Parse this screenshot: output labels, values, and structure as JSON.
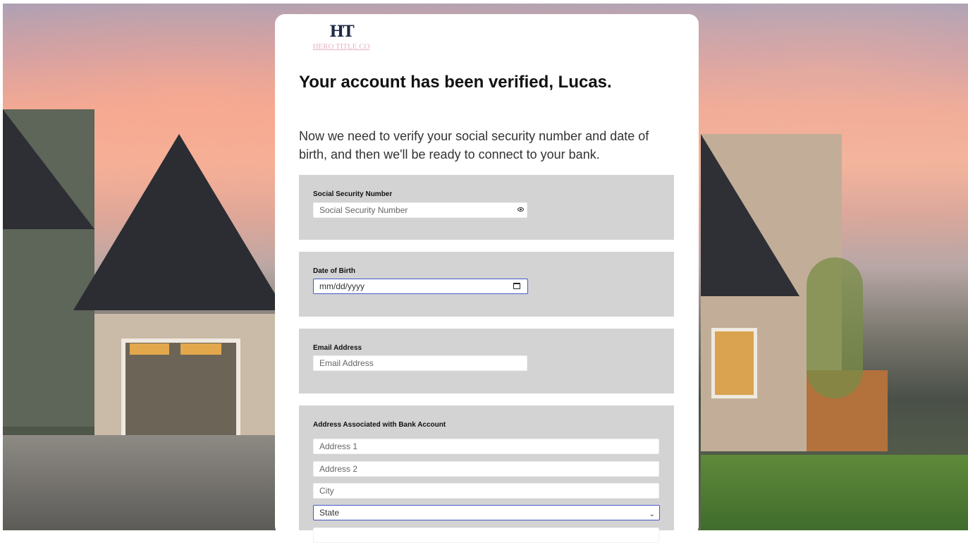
{
  "brand": {
    "logo_mark": "HT",
    "logo_text": "HERO TITLE CO"
  },
  "heading": "Your account has been verified, Lucas.",
  "intro": "Now we need to verify your social security number and date of birth, and then we'll be ready to connect to your bank.",
  "ssn": {
    "label": "Social Security Number",
    "placeholder": "Social Security Number",
    "icon": "eye-icon"
  },
  "dob": {
    "label": "Date of Birth",
    "placeholder": "mm/dd/yyyy",
    "icon": "calendar-icon"
  },
  "email": {
    "label": "Email Address",
    "placeholder": "Email Address"
  },
  "address": {
    "label": "Address Associated with Bank Account",
    "address1_placeholder": "Address 1",
    "address2_placeholder": "Address 2",
    "city_placeholder": "City",
    "state_value": "State"
  },
  "colors": {
    "card": "#ffffff",
    "section": "#d3d3d3",
    "focus": "#4a57c8",
    "logo_pink": "#e7b2c7"
  }
}
